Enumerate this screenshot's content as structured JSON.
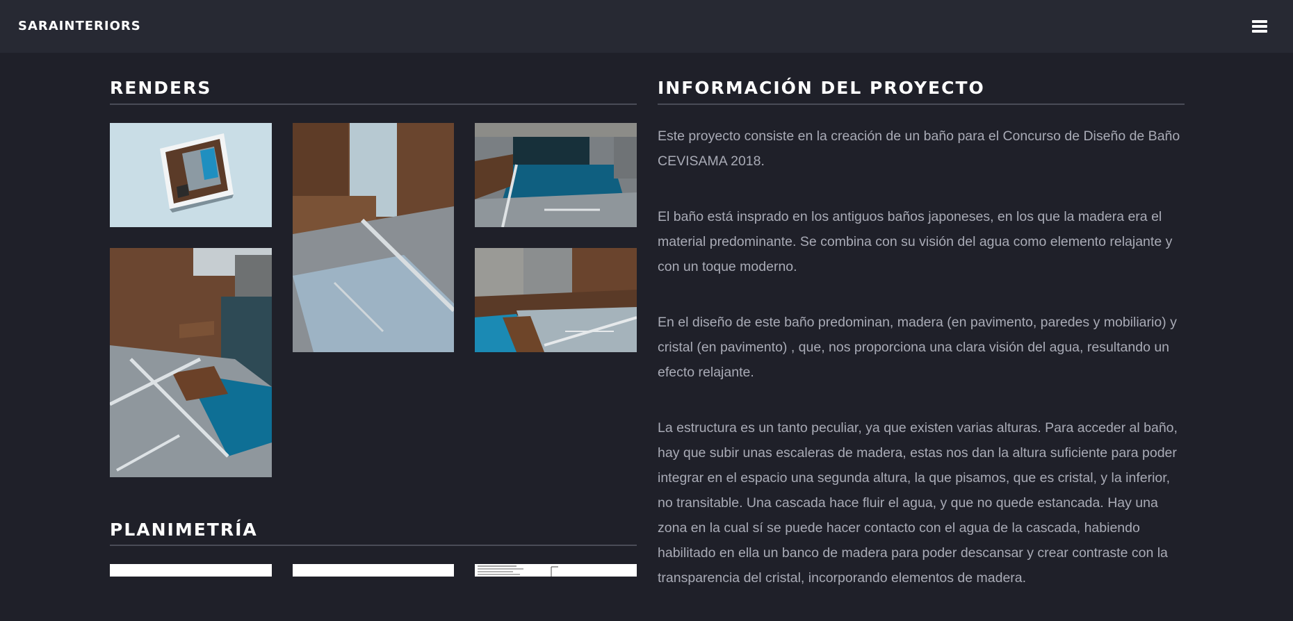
{
  "header": {
    "brand": "SARAINTERIORS",
    "menu_icon": "hamburger-menu-icon"
  },
  "renders": {
    "title": "RENDERS",
    "images": [
      {
        "name": "render-aerial-view"
      },
      {
        "name": "render-bench-corner"
      },
      {
        "name": "render-glass-pool"
      },
      {
        "name": "render-stairs-waterfall"
      },
      {
        "name": "render-wood-bench-pool"
      }
    ]
  },
  "planimetria": {
    "title": "PLANIMETRÍA"
  },
  "info": {
    "title": "INFORMACIÓN DEL PROYECTO",
    "paragraphs": [
      "Este proyecto consiste en la creación de un baño para el Concurso de Diseño de Baño CEVISAMA 2018.",
      "El baño está insprado en los antiguos baños japoneses, en los que la madera era el material predominante. Se combina con su visión del agua como elemento relajante y con un toque moderno.",
      "En el diseño de este baño predominan, madera (en pavimento, paredes y mobiliario) y cristal (en pavimento) , que, nos proporciona una clara visión del agua, resultando un efecto relajante.",
      "La estructura es un tanto peculiar, ya que existen varias alturas. Para acceder al baño, hay que subir unas escaleras de madera, estas nos dan la altura suficiente para poder integrar en el espacio una segunda altura, la que pisamos, que es cristal, y la inferior, no transitable. Una cascada hace fluir el agua, y que no quede estancada. Hay una zona en la cual sí se puede hacer contacto con el agua de la cascada, habiendo habilitado en ella un banco de madera para poder descansar y crear contraste con la transparencia del cristal, incorporando elementos de madera."
    ]
  },
  "colors": {
    "background": "#1f2029",
    "header": "#272933",
    "text": "#a9abb6",
    "heading": "#ffffff"
  }
}
